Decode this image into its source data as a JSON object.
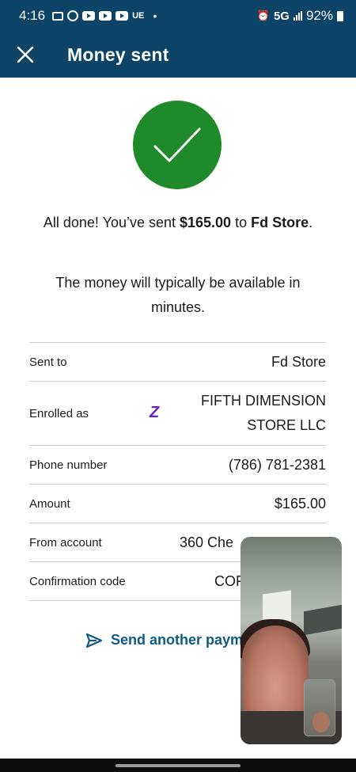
{
  "status_bar": {
    "time": "4:16",
    "ue_label": "UE",
    "network": "5G",
    "battery": "92%"
  },
  "header": {
    "title": "Money sent",
    "close_icon": "close-icon"
  },
  "confirmation": {
    "msg_prefix": "All done! You’ve sent ",
    "amount": "$165.00",
    "msg_mid": " to ",
    "recipient": "Fd Store",
    "msg_suffix": ".",
    "availability": "The money will typically be available in minutes."
  },
  "details": {
    "sent_to_label": "Sent to",
    "sent_to_value": "Fd Store",
    "enrolled_label": "Enrolled as",
    "enrolled_value": "FIFTH DIMENSION STORE LLC",
    "phone_label": "Phone number",
    "phone_value": "(786) 781-2381",
    "amount_label": "Amount",
    "amount_value": "$165.00",
    "from_label": "From account",
    "from_value": "360 Che",
    "code_label": "Confirmation code",
    "code_value": "COF"
  },
  "actions": {
    "send_another_label": "Send another paym"
  },
  "colors": {
    "header_bg": "#0b4466",
    "success_green": "#1f8a2a",
    "link_blue": "#0e5a84",
    "zelle_purple": "#6d1ed4"
  }
}
